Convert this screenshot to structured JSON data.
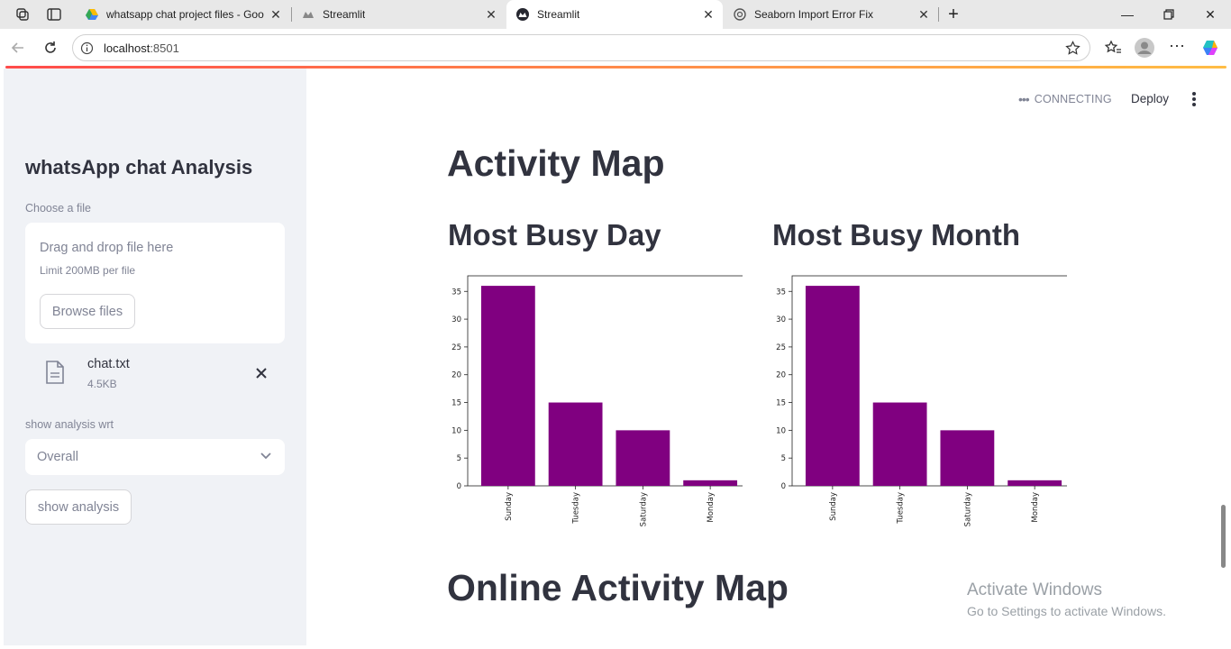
{
  "browser": {
    "tabs": [
      {
        "title": "whatsapp chat project files - Goo",
        "icon": "google-drive-icon",
        "active": false
      },
      {
        "title": "Streamlit",
        "icon": "streamlit-icon",
        "active": false
      },
      {
        "title": "Streamlit",
        "icon": "streamlit-icon",
        "active": true
      },
      {
        "title": "Seaborn Import Error Fix",
        "icon": "chatgpt-icon",
        "active": false
      }
    ],
    "url_host": "localhost",
    "url_port": ":8501"
  },
  "sidebar": {
    "title": "whatsApp chat Analysis",
    "file_label": "Choose a file",
    "dropzone_text": "Drag and drop file here",
    "dropzone_limit": "Limit 200MB per file",
    "browse_label": "Browse files",
    "file_name": "chat.txt",
    "file_size": "4.5KB",
    "select_label": "show analysis wrt",
    "select_value": "Overall",
    "submit_label": "show analysis"
  },
  "header": {
    "status": "CONNECTING",
    "deploy_label": "Deploy"
  },
  "main": {
    "heading": "Activity Map",
    "col1_heading": "Most Busy Day",
    "col2_heading": "Most Busy Month",
    "heading2": "Online Activity Map"
  },
  "watermark": {
    "line1": "Activate Windows",
    "line2": "Go to Settings to activate Windows."
  },
  "colors": {
    "bar": "#800080",
    "accent": "#ff4b4b"
  },
  "chart_data": [
    {
      "type": "bar",
      "categories": [
        "Sunday",
        "Tuesday",
        "Saturday",
        "Monday"
      ],
      "values": [
        36,
        15,
        10,
        1
      ],
      "ylim": [
        0,
        37.8
      ],
      "yticks": [
        0,
        5,
        10,
        15,
        20,
        25,
        30,
        35
      ],
      "xlabel": "",
      "ylabel": "",
      "title": ""
    },
    {
      "type": "bar",
      "categories": [
        "Sunday",
        "Tuesday",
        "Saturday",
        "Monday"
      ],
      "values": [
        36,
        15,
        10,
        1
      ],
      "ylim": [
        0,
        37.8
      ],
      "yticks": [
        0,
        5,
        10,
        15,
        20,
        25,
        30,
        35
      ],
      "xlabel": "",
      "ylabel": "",
      "title": ""
    }
  ]
}
